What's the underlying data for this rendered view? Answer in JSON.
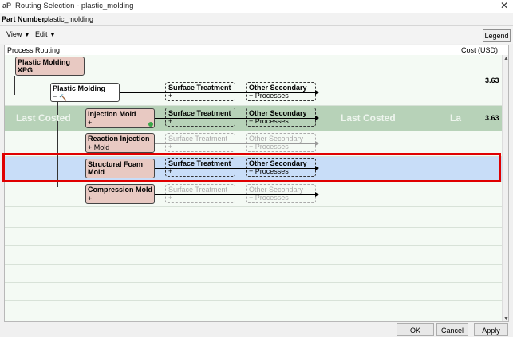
{
  "window": {
    "app_icon": "aP",
    "title": "Routing Selection - plastic_molding",
    "close_glyph": "✕"
  },
  "part": {
    "label": "Part Number:",
    "value": "plastic_molding"
  },
  "menu": {
    "view": "View",
    "edit": "Edit",
    "legend": "Legend"
  },
  "columns": {
    "routing": "Process Routing",
    "cost": "Cost (USD)"
  },
  "tree": {
    "root": {
      "label": "Plastic Molding XPG",
      "toggle": "−"
    },
    "group": {
      "label": "Plastic Molding",
      "toggle": "−"
    }
  },
  "processes": [
    {
      "label": "Injection Mold",
      "sub": "+"
    },
    {
      "label": "Reaction Injection",
      "sub": "+ Mold"
    },
    {
      "label": "Structural Foam Mold",
      "sub": "+"
    },
    {
      "label": "Compression Mold",
      "sub": "+"
    }
  ],
  "secondary": {
    "surface": "Surface Treatment",
    "other_line1": "Other Secondary",
    "other_line2": "+ Processes",
    "plus": "+",
    "other_faded": "Other Secondary",
    "other_faded_sub": "+ Processes"
  },
  "last_costed": {
    "text": "Last Costed",
    "text_cut": "La"
  },
  "costs": {
    "group_cost": "3.63",
    "injection_cost": "3.63"
  },
  "buttons": {
    "ok": "OK",
    "cancel": "Cancel",
    "apply": "Apply"
  }
}
